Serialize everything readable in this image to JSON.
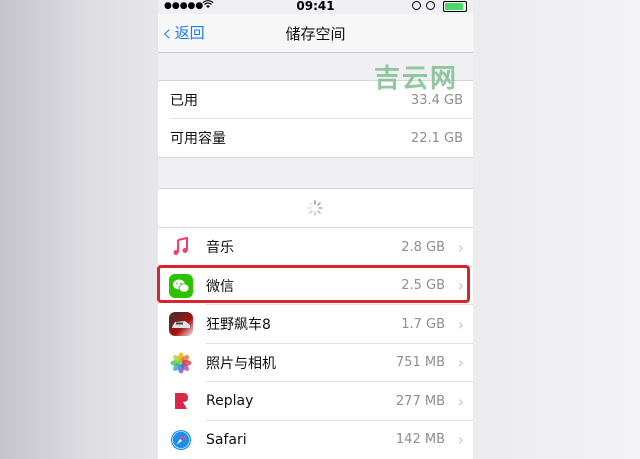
{
  "status_bar": {
    "signal": "●●●●●",
    "time": "09:41",
    "battery_color": "#4cd964"
  },
  "nav": {
    "back_label": "返回",
    "title": "储存空间"
  },
  "storage": [
    {
      "label": "已用",
      "value": "33.4 GB"
    },
    {
      "label": "可用容量",
      "value": "22.1 GB"
    }
  ],
  "apps": [
    {
      "name": "音乐",
      "size": "2.8 GB",
      "icon": "music-note-icon"
    },
    {
      "name": "微信",
      "size": "2.5 GB",
      "icon": "wechat-icon"
    },
    {
      "name": "狂野飙车8",
      "size": "1.7 GB",
      "icon": "asphalt-8-icon"
    },
    {
      "name": "照片与相机",
      "size": "751 MB",
      "icon": "photos-icon"
    },
    {
      "name": "Replay",
      "size": "277 MB",
      "icon": "replay-icon"
    },
    {
      "name": "Safari",
      "size": "142 MB",
      "icon": "safari-icon"
    }
  ],
  "chevron": "›",
  "watermark": "吉云网",
  "colors": {
    "accent": "#1a7cf5",
    "highlight": "#d7262b",
    "wechat": "#2dc100"
  }
}
